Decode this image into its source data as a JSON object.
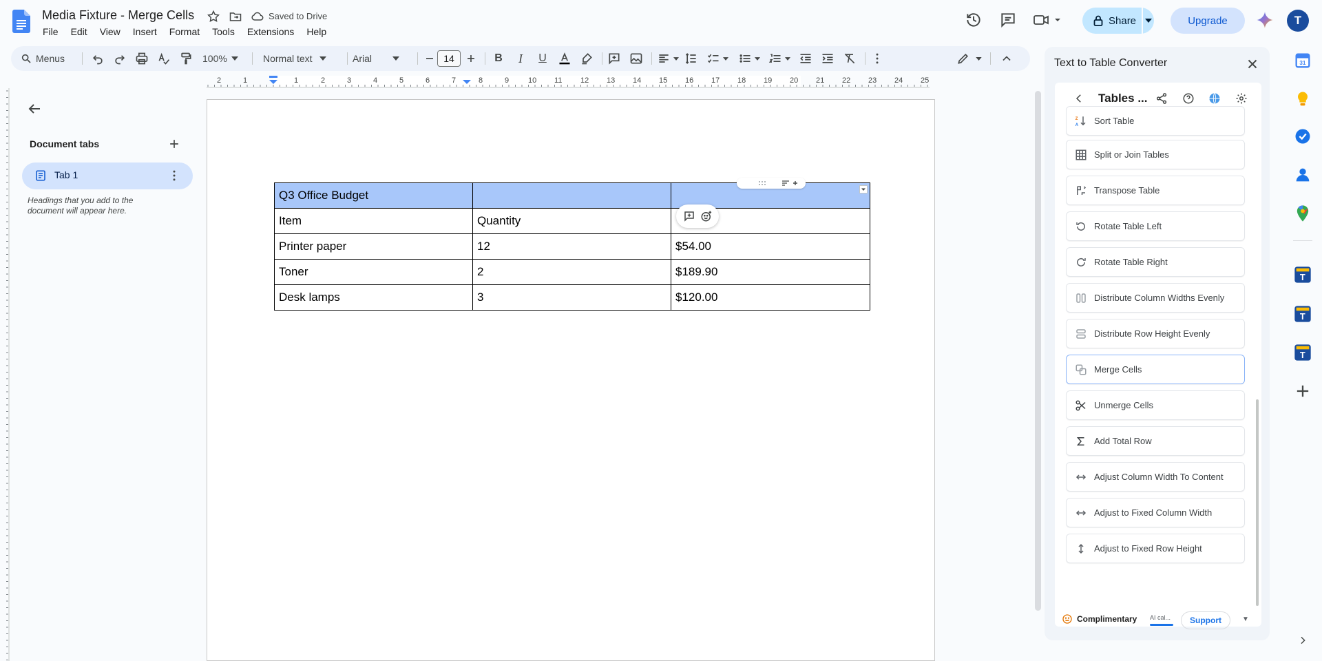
{
  "title_bar": {
    "doc_title": "Media Fixture - Merge Cells",
    "saved_status": "Saved to Drive",
    "share_label": "Share",
    "upgrade_label": "Upgrade",
    "avatar_initial": "T"
  },
  "menu": [
    "File",
    "Edit",
    "View",
    "Insert",
    "Format",
    "Tools",
    "Extensions",
    "Help"
  ],
  "toolbar": {
    "menus_label": "Menus",
    "zoom": "100%",
    "style": "Normal text",
    "font": "Arial",
    "font_size": "14"
  },
  "ruler": [
    "2",
    "1",
    "1",
    "2",
    "3",
    "4",
    "5",
    "6",
    "7",
    "8",
    "9",
    "10",
    "11",
    "12",
    "13",
    "14",
    "15",
    "16",
    "17",
    "18",
    "19",
    "20",
    "21",
    "22",
    "23",
    "24",
    "25"
  ],
  "outline": {
    "section_label": "Document tabs",
    "tab_label": "Tab 1",
    "hint": "Headings that you add to the document will appear here."
  },
  "table": {
    "rows": [
      [
        "Q3 Office Budget",
        "",
        ""
      ],
      [
        "Item",
        "Quantity",
        ""
      ],
      [
        "Printer paper",
        "12",
        "$54.00"
      ],
      [
        "Toner",
        "2",
        "$189.90"
      ],
      [
        "Desk lamps",
        "3",
        "$120.00"
      ]
    ]
  },
  "side_panel": {
    "title": "Text to Table Converter",
    "header_title": "Tables ...",
    "items": [
      {
        "label": "Sort Table",
        "icon": "sort-az-icon"
      },
      {
        "label": "Split or Join Tables",
        "icon": "grid-icon"
      },
      {
        "label": "Transpose Table",
        "icon": "transpose-icon"
      },
      {
        "label": "Rotate Table Left",
        "icon": "rotate-left-icon"
      },
      {
        "label": "Rotate Table Right",
        "icon": "rotate-right-icon"
      },
      {
        "label": "Distribute Column Widths Evenly",
        "icon": "distribute-columns-icon"
      },
      {
        "label": "Distribute Row Height Evenly",
        "icon": "distribute-rows-icon"
      },
      {
        "label": "Merge Cells",
        "icon": "merge-icon"
      },
      {
        "label": "Unmerge Cells",
        "icon": "scissors-icon"
      },
      {
        "label": "Add Total Row",
        "icon": "sigma-icon"
      },
      {
        "label": "Adjust Column Width To Content",
        "icon": "width-arrows-icon"
      },
      {
        "label": "Adjust to Fixed Column Width",
        "icon": "width-arrows-icon"
      },
      {
        "label": "Adjust to Fixed Row Height",
        "icon": "height-arrows-icon"
      }
    ],
    "footer": {
      "plan_label": "Complimentary",
      "ai_label": "AI cal...",
      "support_label": "Support"
    }
  },
  "colors": {
    "accent": "#0b57d0",
    "header_cell_bg": "#a8c7fa",
    "share_bg": "#c2e7ff",
    "upgrade_bg": "#d3e3fd"
  }
}
